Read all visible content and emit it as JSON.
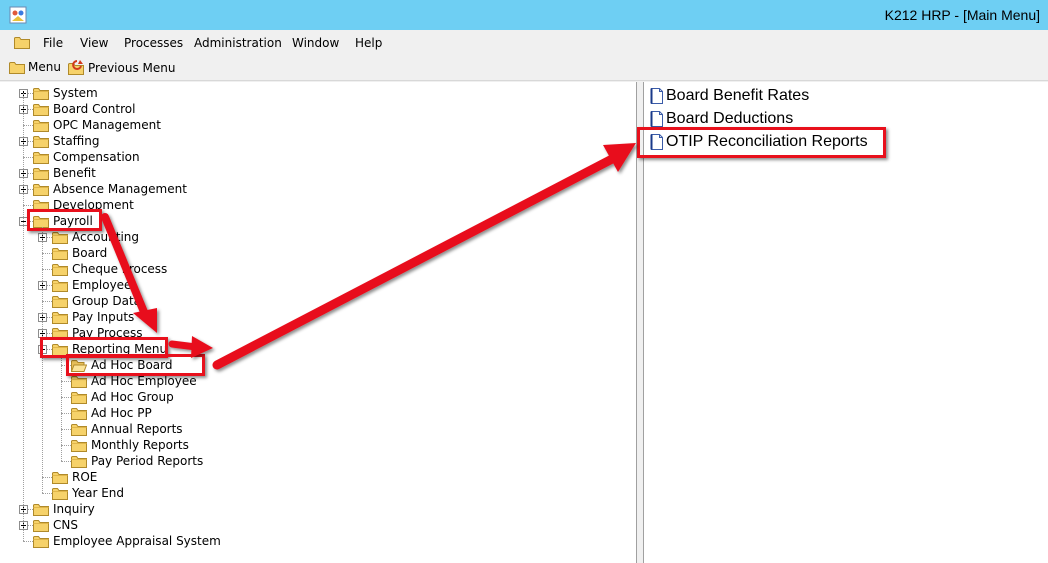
{
  "window": {
    "title": "K212 HRP - [Main Menu]"
  },
  "menubar": [
    "File",
    "View",
    "Processes",
    "Administration",
    "Window",
    "Help"
  ],
  "toolbar": {
    "menu_label": "Menu",
    "previous_menu_label": "Previous Menu"
  },
  "tree": [
    {
      "label": "System",
      "level": 0,
      "expander": "plus"
    },
    {
      "label": "Board Control",
      "level": 0,
      "expander": "plus"
    },
    {
      "label": "OPC Management",
      "level": 0,
      "expander": "none"
    },
    {
      "label": "Staffing",
      "level": 0,
      "expander": "plus"
    },
    {
      "label": "Compensation",
      "level": 0,
      "expander": "none"
    },
    {
      "label": "Benefit",
      "level": 0,
      "expander": "plus"
    },
    {
      "label": "Absence Management",
      "level": 0,
      "expander": "plus"
    },
    {
      "label": "Development",
      "level": 0,
      "expander": "none"
    },
    {
      "label": "Payroll",
      "level": 0,
      "expander": "minus"
    },
    {
      "label": "Accounting",
      "level": 1,
      "expander": "plus"
    },
    {
      "label": "Board",
      "level": 1,
      "expander": "none"
    },
    {
      "label": "Cheque Process",
      "level": 1,
      "expander": "none"
    },
    {
      "label": "Employee",
      "level": 1,
      "expander": "plus"
    },
    {
      "label": "Group Data",
      "level": 1,
      "expander": "none"
    },
    {
      "label": "Pay Inputs",
      "level": 1,
      "expander": "plus"
    },
    {
      "label": "Pay Process",
      "level": 1,
      "expander": "plus"
    },
    {
      "label": "Reporting Menu",
      "level": 1,
      "expander": "minus"
    },
    {
      "label": "Ad Hoc Board",
      "level": 2,
      "expander": "none",
      "open": true
    },
    {
      "label": "Ad Hoc Employee",
      "level": 2,
      "expander": "none"
    },
    {
      "label": "Ad Hoc Group",
      "level": 2,
      "expander": "none"
    },
    {
      "label": "Ad Hoc PP",
      "level": 2,
      "expander": "none"
    },
    {
      "label": "Annual Reports",
      "level": 2,
      "expander": "none"
    },
    {
      "label": "Monthly Reports",
      "level": 2,
      "expander": "none"
    },
    {
      "label": "Pay Period Reports",
      "level": 2,
      "expander": "none"
    },
    {
      "label": "ROE",
      "level": 1,
      "expander": "none"
    },
    {
      "label": "Year End",
      "level": 1,
      "expander": "none"
    },
    {
      "label": "Inquiry",
      "level": 0,
      "expander": "plus"
    },
    {
      "label": "CNS",
      "level": 0,
      "expander": "plus"
    },
    {
      "label": "Employee Appraisal System",
      "level": 0,
      "expander": "none"
    }
  ],
  "reports": [
    "Board Benefit Rates",
    "Board Deductions",
    "OTIP Reconciliation Reports"
  ],
  "colors": {
    "titlebar": "#6ecff3",
    "highlight": "#e8101c",
    "folder": "#f6d26a"
  }
}
